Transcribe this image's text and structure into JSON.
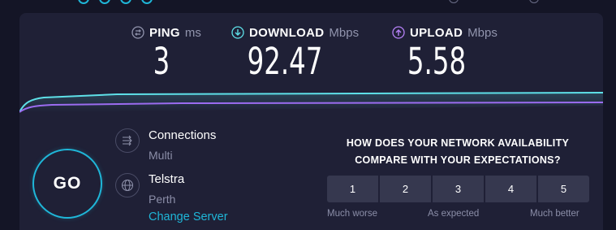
{
  "colors": {
    "background": "#141526",
    "panel": "#1f2036",
    "accent_cyan": "#1fb6d8",
    "download_icon": "#5ee0e8",
    "upload_icon": "#b480f5",
    "download_line": "#5ee0e8",
    "upload_line": "#9b6cf0",
    "muted_text": "#8b8ea8",
    "rating_button": "#36384f"
  },
  "metrics": {
    "ping": {
      "label": "PING",
      "unit": "ms",
      "value": "3",
      "icon": "ping-icon"
    },
    "download": {
      "label": "DOWNLOAD",
      "unit": "Mbps",
      "value": "92.47",
      "icon": "download-arrow-icon"
    },
    "upload": {
      "label": "UPLOAD",
      "unit": "Mbps",
      "value": "5.58",
      "icon": "upload-arrow-icon"
    }
  },
  "go_button": {
    "label": "GO"
  },
  "connections": {
    "title": "Connections",
    "value": "Multi",
    "icon": "connections-icon"
  },
  "server": {
    "provider": "Telstra",
    "location": "Perth",
    "change_link": "Change Server",
    "icon": "globe-icon"
  },
  "survey": {
    "question_line1": "HOW DOES YOUR NETWORK AVAILABILITY",
    "question_line2": "COMPARE WITH YOUR EXPECTATIONS?",
    "options": [
      "1",
      "2",
      "3",
      "4",
      "5"
    ],
    "scale_low": "Much worse",
    "scale_mid": "As expected",
    "scale_high": "Much better"
  }
}
